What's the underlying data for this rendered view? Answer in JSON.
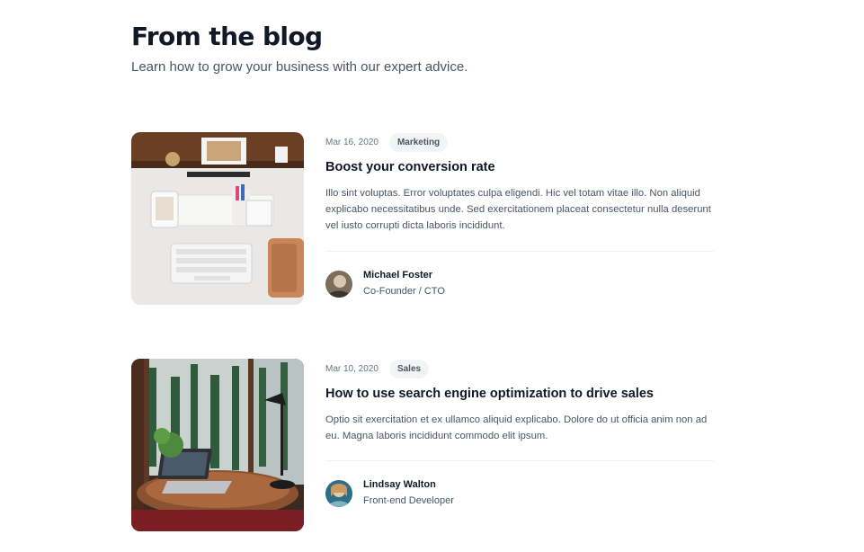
{
  "header": {
    "title": "From the blog",
    "subtitle": "Learn how to grow your business with our expert advice."
  },
  "posts": [
    {
      "date": "Mar 16, 2020",
      "category": "Marketing",
      "title": "Boost your conversion rate",
      "excerpt": "Illo sint voluptas. Error voluptates culpa eligendi. Hic vel totam vitae illo. Non aliquid explicabo necessitatibus unde. Sed exercitationem placeat consectetur nulla deserunt vel iusto corrupti dicta laboris incididunt.",
      "author": {
        "name": "Michael Foster",
        "role": "Co-Founder / CTO"
      }
    },
    {
      "date": "Mar 10, 2020",
      "category": "Sales",
      "title": "How to use search engine optimization to drive sales",
      "excerpt": "Optio sit exercitation et ex ullamco aliquid explicabo. Dolore do ut officia anim non ad eu. Magna laboris incididunt commodo elit ipsum.",
      "author": {
        "name": "Lindsay Walton",
        "role": "Front-end Developer"
      }
    }
  ],
  "colors": {
    "heading": "#111827",
    "body_text": "#4b5563",
    "tag_background": "#f3f4f6",
    "divider": "#f0f1f3"
  }
}
